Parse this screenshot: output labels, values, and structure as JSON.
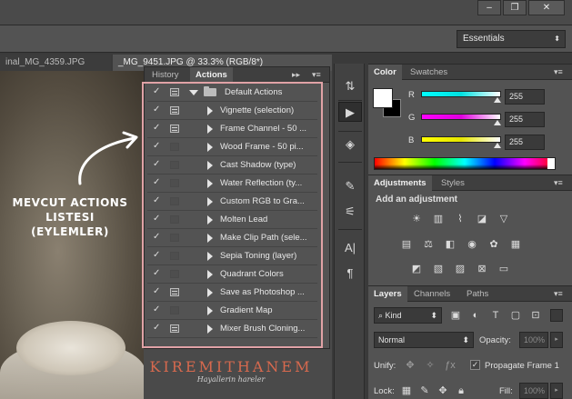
{
  "window": {
    "min_icon": "minimize-icon",
    "restore_icon": "restore-icon",
    "close_icon": "close-icon"
  },
  "workspace": {
    "selected": "Essentials"
  },
  "documents": {
    "tabs": [
      {
        "label": "inal_MG_4359.JPG"
      },
      {
        "label": "_MG_9451.JPG @ 33.3% (RGB/8*)"
      }
    ]
  },
  "annotation": {
    "line1": "MEVCUT ACTIONS LISTESI",
    "line2": "(EYLEMLER)"
  },
  "actions_panel": {
    "tabs": [
      "History",
      "Actions"
    ],
    "active_tab": "Actions",
    "folder": "Default Actions",
    "items": [
      {
        "label": "Vignette (selection)",
        "dialog": true
      },
      {
        "label": "Frame Channel - 50 ...",
        "dialog": true
      },
      {
        "label": "Wood Frame - 50 pi...",
        "dialog": false
      },
      {
        "label": "Cast Shadow (type)",
        "dialog": false
      },
      {
        "label": "Water Reflection (ty...",
        "dialog": false
      },
      {
        "label": "Custom RGB to Gra...",
        "dialog": false
      },
      {
        "label": "Molten Lead",
        "dialog": false
      },
      {
        "label": "Make Clip Path (sele...",
        "dialog": false
      },
      {
        "label": "Sepia Toning (layer)",
        "dialog": false
      },
      {
        "label": "Quadrant Colors",
        "dialog": false
      },
      {
        "label": "Save as Photoshop ...",
        "dialog": true
      },
      {
        "label": "Gradient Map",
        "dialog": false
      },
      {
        "label": "Mixer Brush Cloning...",
        "dialog": true
      }
    ]
  },
  "brand": {
    "name": "KIREMITHANEM",
    "tagline": "Hayallerin hareler"
  },
  "color_panel": {
    "tabs": [
      "Color",
      "Swatches"
    ],
    "channels": [
      {
        "name": "R",
        "value": "255",
        "color": "#00e5e5"
      },
      {
        "name": "G",
        "value": "255",
        "color": "#e000e0"
      },
      {
        "name": "B",
        "value": "255",
        "color": "#e5e500"
      }
    ]
  },
  "adjustments_panel": {
    "tabs": [
      "Adjustments",
      "Styles"
    ],
    "heading": "Add an adjustment"
  },
  "layers_panel": {
    "tabs": [
      "Layers",
      "Channels",
      "Paths"
    ],
    "filter": "Kind",
    "blend_mode": "Normal",
    "opacity_label": "Opacity:",
    "opacity_value": "100%",
    "unify_label": "Unify:",
    "propagate_label": "Propagate Frame 1",
    "lock_label": "Lock:",
    "fill_label": "Fill:",
    "fill_value": "100%"
  },
  "colors": {
    "highlight": "#e0a2a6",
    "brand": "#d7694e"
  }
}
